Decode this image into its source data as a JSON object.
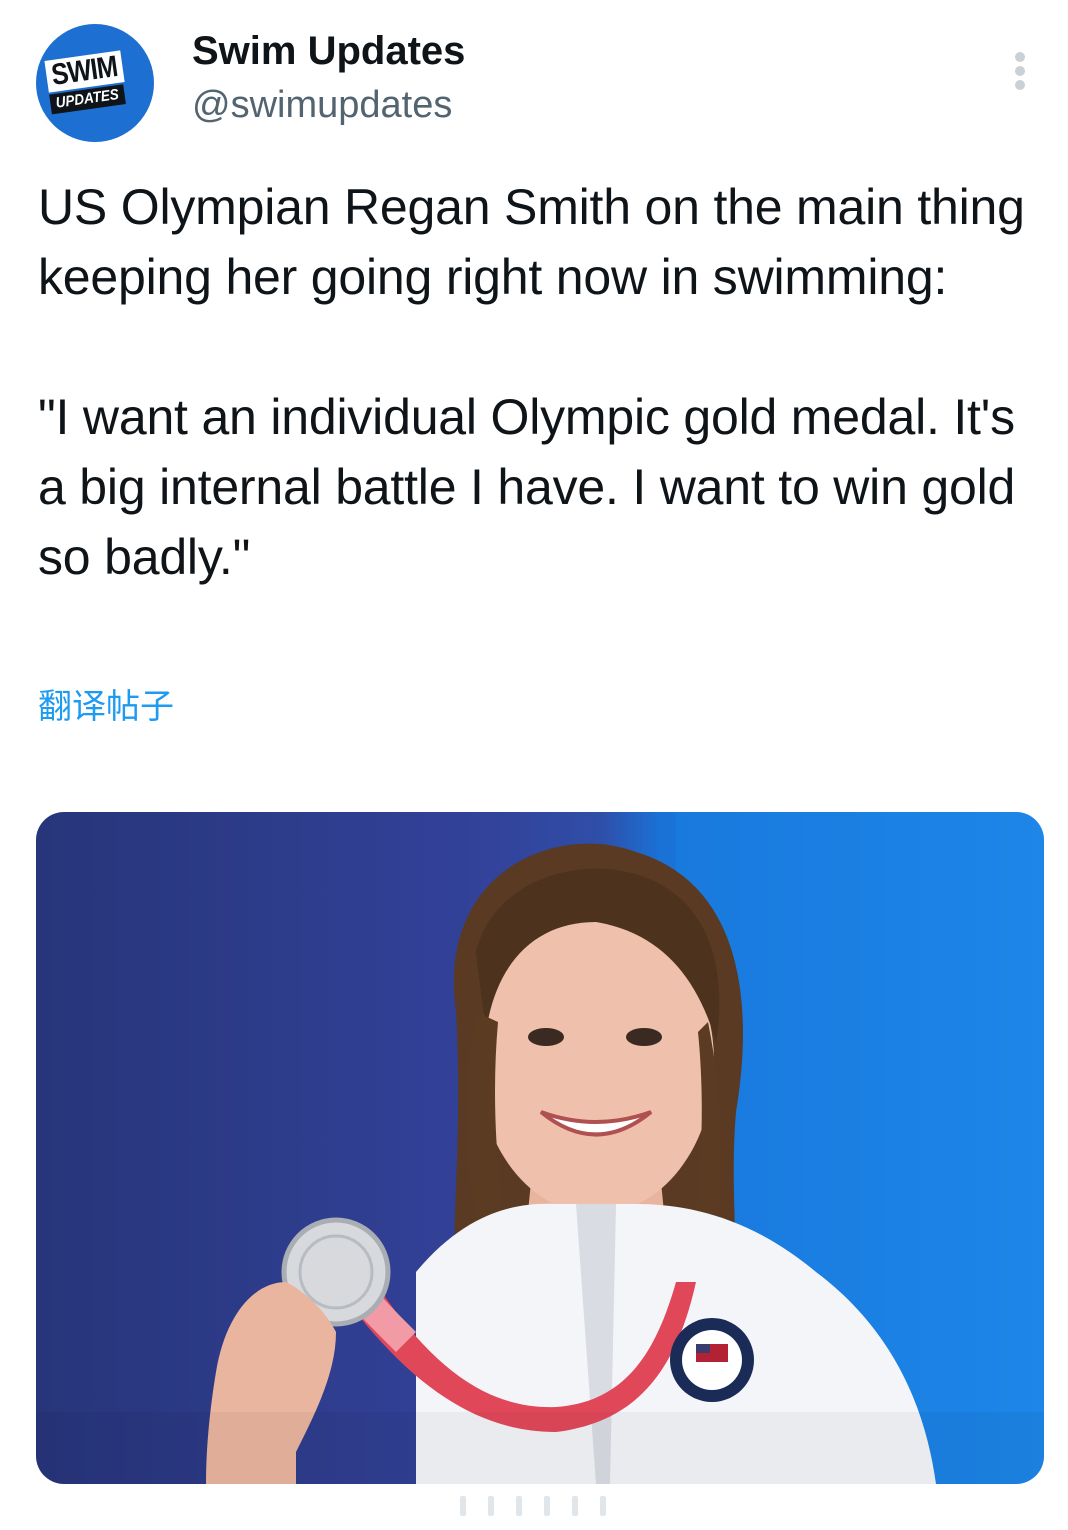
{
  "author": {
    "display_name": "Swim Updates",
    "handle": "@swimupdates",
    "avatar_logo": {
      "line1": "SWIM",
      "line2": "UPDATES"
    }
  },
  "tweet": {
    "paragraph1": "US Olympian Regan Smith on the main thing keeping her going right now in swimming:",
    "paragraph2": "\"I want an individual Olympic gold medal. It's a big internal battle I have. I want to win gold so badly.\"",
    "translate_label": "翻译帖子"
  },
  "media": {
    "kind": "photo"
  },
  "icons": {
    "more": "more-horizontal-icon"
  },
  "colors": {
    "accent": "#1d9bf0",
    "secondary_text": "#536471",
    "avatar_bg": "#1d6fd1"
  }
}
